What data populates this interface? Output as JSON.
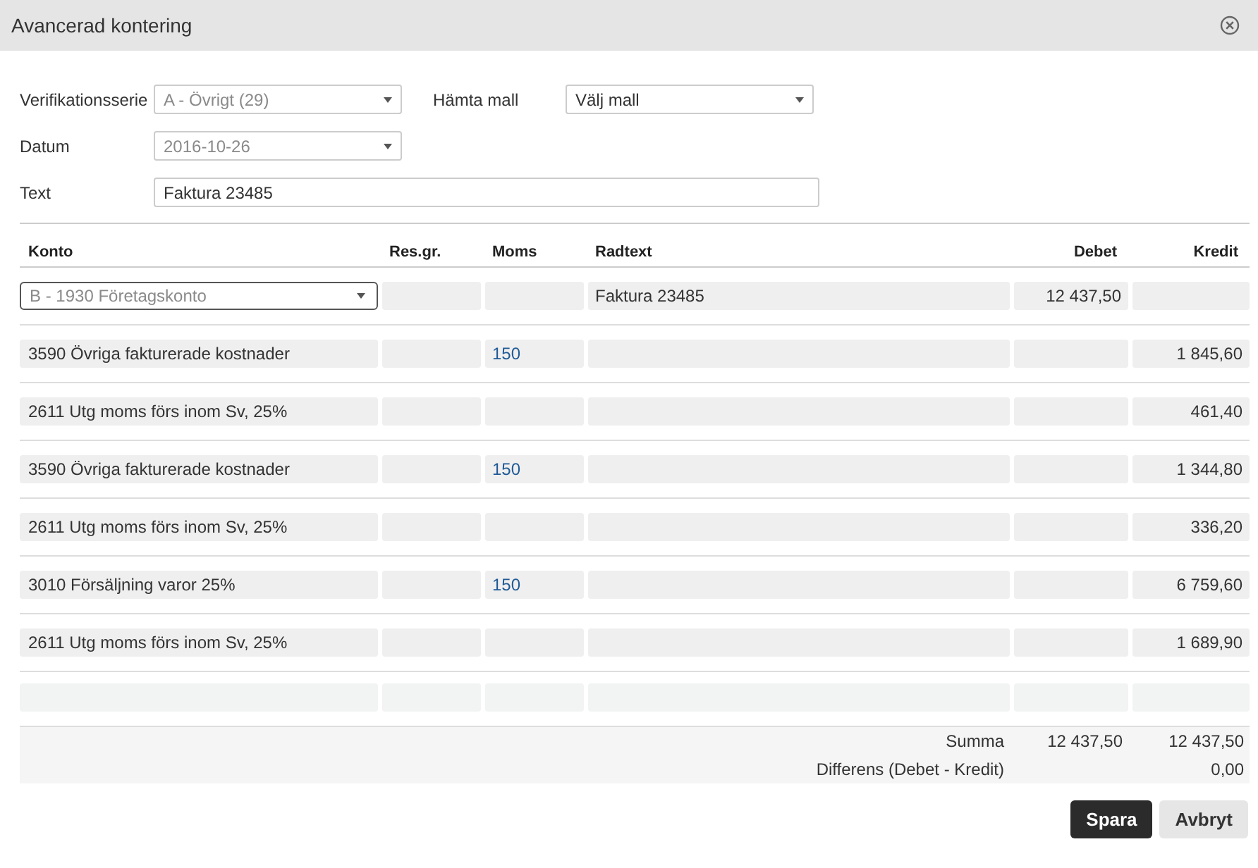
{
  "window": {
    "title": "Avancerad kontering"
  },
  "form": {
    "rows": [
      {
        "fields": [
          {
            "label": "Verifikationsserie",
            "kind": "select",
            "value": "A - Övrigt (29)",
            "disabled": true
          },
          {
            "label": "Hämta mall",
            "kind": "select",
            "value": "Välj mall",
            "disabled": false
          }
        ]
      },
      {
        "fields": [
          {
            "label": "Datum",
            "kind": "select",
            "value": "2016-10-26",
            "disabled": true
          }
        ]
      },
      {
        "fields": [
          {
            "label": "Text",
            "kind": "input",
            "value": "Faktura 23485",
            "disabled": false
          }
        ]
      }
    ]
  },
  "table": {
    "columns": [
      "Konto",
      "Res.gr.",
      "Moms",
      "Radtext",
      "Debet",
      "Kredit"
    ],
    "rows": [
      {
        "kind": "select",
        "konto": "B - 1930 Företagskonto",
        "radtext": "Faktura 23485",
        "debet": "12 437,50"
      },
      {
        "kind": "text",
        "konto": "3590 Övriga fakturerade kostnader",
        "moms": "150",
        "kredit": "1 845,60"
      },
      {
        "kind": "text",
        "konto": "2611 Utg moms förs inom Sv, 25%",
        "kredit": "461,40"
      },
      {
        "kind": "text",
        "konto": "3590 Övriga fakturerade kostnader",
        "moms": "150",
        "kredit": "1 344,80"
      },
      {
        "kind": "text",
        "konto": "2611 Utg moms förs inom Sv, 25%",
        "kredit": "336,20"
      },
      {
        "kind": "text",
        "konto": "3010 Försäljning varor 25%",
        "moms": "150",
        "kredit": "6 759,60"
      },
      {
        "kind": "text",
        "konto": "2611 Utg moms förs inom Sv, 25%",
        "kredit": "1 689,90"
      },
      {
        "kind": "blank"
      }
    ],
    "totals": [
      {
        "label": "Summa",
        "debet": "12 437,50",
        "kredit": "12 437,50"
      },
      {
        "label": "Differens (Debet - Kredit)",
        "kredit": "0,00"
      }
    ]
  },
  "buttons": [
    {
      "label": "Spara",
      "kind": "primary"
    },
    {
      "label": "Avbryt",
      "kind": "secondary"
    }
  ]
}
